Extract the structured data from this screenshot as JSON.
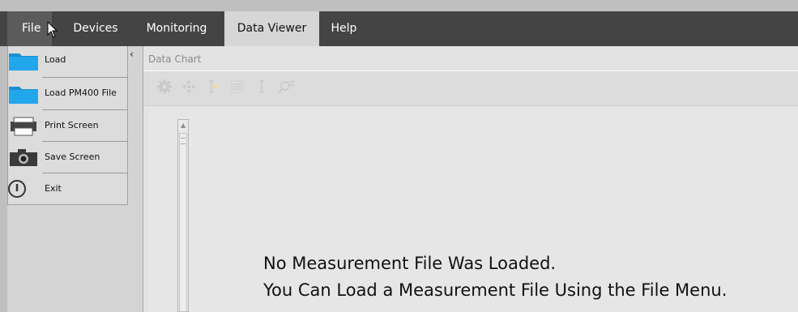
{
  "menubar": {
    "items": [
      {
        "label": "File"
      },
      {
        "label": "Devices"
      },
      {
        "label": "Monitoring"
      },
      {
        "label": "Data Viewer"
      },
      {
        "label": "Help"
      }
    ]
  },
  "file_menu": {
    "items": [
      {
        "label": "Load",
        "icon": "folder-icon"
      },
      {
        "label": "Load PM400 File",
        "icon": "folder-icon"
      },
      {
        "label": "Print Screen",
        "icon": "printer-icon"
      },
      {
        "label": "Save Screen",
        "icon": "camera-icon"
      },
      {
        "label": "Exit",
        "icon": "power-icon"
      }
    ]
  },
  "panel": {
    "title": "Data Chart",
    "toolbar_icons": [
      "gear-icon",
      "move-icon",
      "cursor-marker-icon",
      "list-icon",
      "text-cursor-icon",
      "zoom-icon"
    ]
  },
  "message": {
    "line1": "No Measurement File Was Loaded.",
    "line2": "You Can Load a Measurement File Using the File Menu."
  },
  "colors": {
    "menubar": "#444444",
    "active_tab": "#d6d6d6",
    "folder": "#1ea0e6",
    "toolbar_icon": "#c8c8c8"
  }
}
